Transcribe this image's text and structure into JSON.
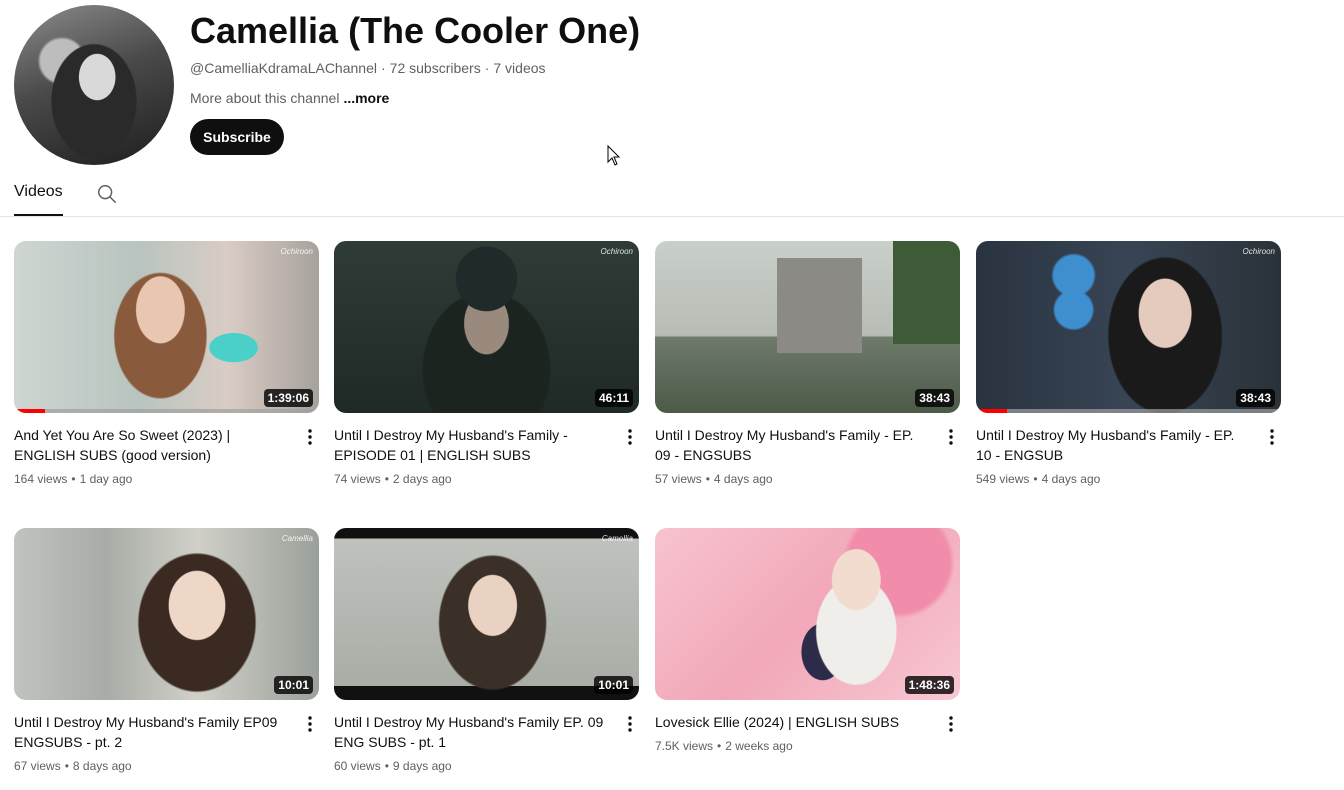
{
  "channel": {
    "name": "Camellia (The Cooler One)",
    "handle": "@CamelliaKdramaLAChannel",
    "subscribers": "72 subscribers",
    "video_count": "7 videos",
    "about": "More about this channel",
    "more_label": "...more",
    "subscribe_label": "Subscribe",
    "meta_separator": "·"
  },
  "tabs": {
    "videos_label": "Videos"
  },
  "videos": [
    {
      "title": "And Yet You Are So Sweet (2023) | ENGLISH SUBS (good version)",
      "duration": "1:39:06",
      "views": "164 views",
      "age": "1 day ago",
      "watermark": "Ochiroon",
      "watch_progress": 0.1
    },
    {
      "title": "Until I Destroy My Husband's Family - EPISODE 01 | ENGLISH SUBS",
      "duration": "46:11",
      "views": "74 views",
      "age": "2 days ago",
      "watermark": "Ochiroon",
      "watch_progress": 0
    },
    {
      "title": "Until I Destroy My Husband's Family - EP. 09 - ENGSUBS",
      "duration": "38:43",
      "views": "57 views",
      "age": "4 days ago",
      "watermark": "Ochiroon",
      "watch_progress": 0
    },
    {
      "title": "Until I Destroy My Husband's Family - EP. 10 - ENGSUB",
      "duration": "38:43",
      "views": "549 views",
      "age": "4 days ago",
      "watermark": "Ochiroon",
      "watch_progress": 0.1
    },
    {
      "title": "Until I Destroy My Husband's Family EP09 ENGSUBS - pt. 2",
      "duration": "10:01",
      "views": "67 views",
      "age": "8 days ago",
      "watermark": "Camellia",
      "watch_progress": 0
    },
    {
      "title": "Until I Destroy My Husband's Family EP. 09 ENG SUBS - pt. 1",
      "duration": "10:01",
      "views": "60 views",
      "age": "9 days ago",
      "watermark": "Camellia",
      "watch_progress": 0
    },
    {
      "title": "Lovesick Ellie (2024) | ENGLISH SUBS",
      "duration": "1:48:36",
      "views": "7.5K views",
      "age": "2 weeks ago",
      "watermark": "",
      "watch_progress": 0
    }
  ],
  "dot_separator": "•",
  "icons": {
    "search": "search-icon",
    "more_actions": "more-vert-icon",
    "cursor": "mouse-pointer-icon"
  },
  "colors": {
    "progress": "#ff0000",
    "subscribe_bg": "#0f0f0f",
    "secondary_text": "#606060"
  }
}
